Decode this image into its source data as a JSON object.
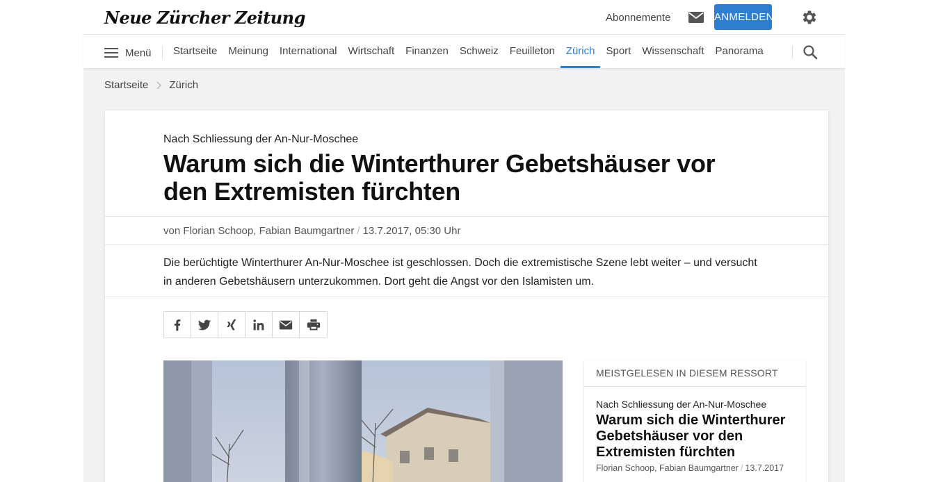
{
  "header": {
    "logo": "Neue Zürcher Zeitung",
    "subscriptions_link": "Abonnemente",
    "login_button": "ANMELDEN"
  },
  "nav": {
    "menu_label": "Menü",
    "items": [
      {
        "label": "Startseite"
      },
      {
        "label": "Meinung"
      },
      {
        "label": "International"
      },
      {
        "label": "Wirtschaft"
      },
      {
        "label": "Finanzen"
      },
      {
        "label": "Schweiz"
      },
      {
        "label": "Feuilleton"
      },
      {
        "label": "Zürich",
        "active": true
      },
      {
        "label": "Sport"
      },
      {
        "label": "Wissenschaft"
      },
      {
        "label": "Panorama"
      }
    ]
  },
  "breadcrumb": {
    "home": "Startseite",
    "current": "Zürich"
  },
  "article": {
    "kicker": "Nach Schliessung der An-Nur-Moschee",
    "headline": "Warum sich die Winterthurer Gebetshäuser vor den Extremisten fürchten",
    "authors": "von Florian Schoop, Fabian Baumgartner",
    "date": "13.7.2017, 05:30 Uhr",
    "lead": "Die berüchtigte Winterthurer An-Nur-Moschee ist geschlossen. Doch die extremistische Szene lebt weiter – und versucht in anderen Gebetshäusern unterzukommen. Dort geht die Angst vor den Islamisten um."
  },
  "share_icons": [
    "facebook-icon",
    "twitter-icon",
    "xing-icon",
    "linkedin-icon",
    "mail-icon",
    "print-icon"
  ],
  "sidebar": {
    "heading": "MEISTGELESEN IN DIESEM RESSORT",
    "item": {
      "kicker": "Nach Schliessung der An-Nur-Moschee",
      "title": "Warum sich die Winterthurer Gebetshäuser vor den Extremisten fürchten",
      "authors": "Florian Schoop, Fabian Baumgartner",
      "date": "13.7.2017"
    }
  },
  "colors": {
    "accent": "#2f7fd1",
    "background": "#f2f2f2"
  }
}
